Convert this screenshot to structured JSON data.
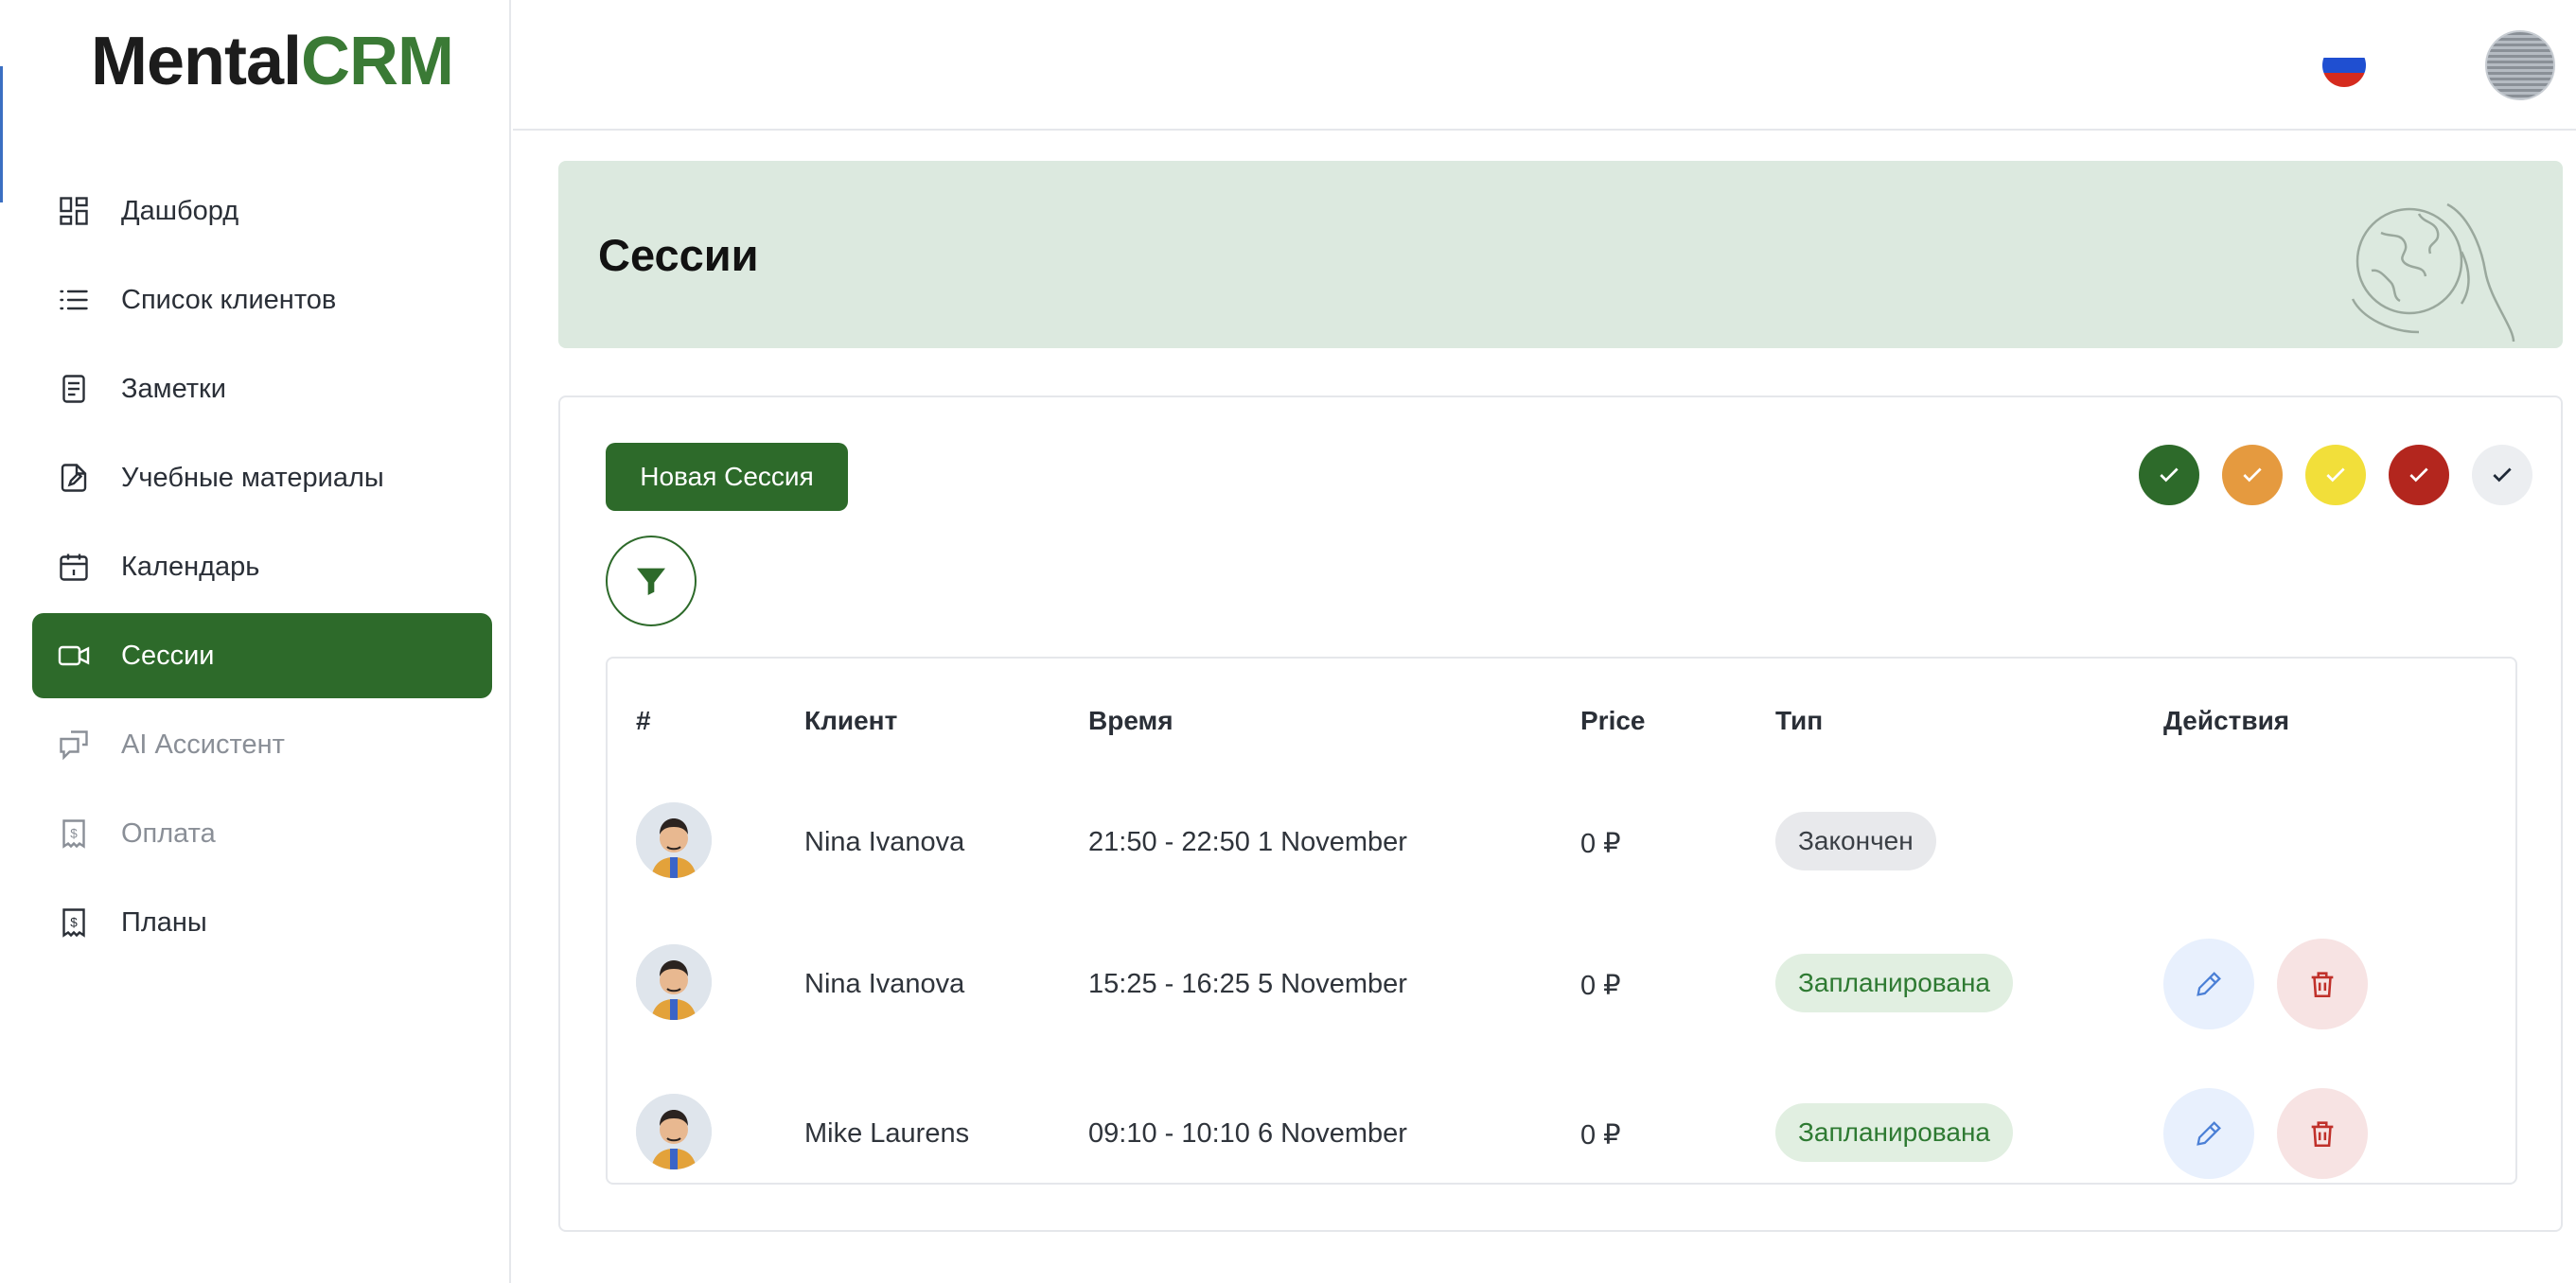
{
  "brand": {
    "part1": "Mental",
    "part2": "CRM"
  },
  "sidebar": {
    "items": [
      {
        "label": "Дашборд",
        "icon": "dashboard-icon"
      },
      {
        "label": "Список клиентов",
        "icon": "list-icon"
      },
      {
        "label": "Заметки",
        "icon": "notes-icon"
      },
      {
        "label": "Учебные материалы",
        "icon": "document-edit-icon"
      },
      {
        "label": "Календарь",
        "icon": "calendar-icon"
      },
      {
        "label": "Сессии",
        "icon": "video-icon",
        "active": true
      },
      {
        "label": "AI Ассистент",
        "icon": "chat-icon",
        "muted": true
      },
      {
        "label": "Оплата",
        "icon": "receipt-icon",
        "muted": true
      },
      {
        "label": "Планы",
        "icon": "receipt-icon"
      }
    ]
  },
  "header": {
    "language": "ru",
    "flag_colors": [
      "#ffffff",
      "#1f4fd1",
      "#d52b1e"
    ]
  },
  "page": {
    "title": "Сессии"
  },
  "toolbar": {
    "new_session_label": "Новая Сессия"
  },
  "status_colors": [
    "#2d6a2a",
    "#e59a3f",
    "#f2df3a",
    "#b3261e",
    "#eceef1"
  ],
  "table": {
    "headers": {
      "num": "#",
      "client": "Клиент",
      "time": "Время",
      "price": "Price",
      "type": "Тип",
      "actions": "Действия"
    },
    "rows": [
      {
        "client": "Nina Ivanova",
        "time": "21:50 - 22:50 1 November",
        "price": "0 ₽",
        "type": "Закончен",
        "status": "done",
        "actions": false
      },
      {
        "client": "Nina Ivanova",
        "time": "15:25 - 16:25 5 November",
        "price": "0 ₽",
        "type": "Запланирована",
        "status": "planned",
        "actions": true
      },
      {
        "client": "Mike Laurens",
        "time": "09:10 - 10:10 6 November",
        "price": "0 ₽",
        "type": "Запланирована",
        "status": "planned",
        "actions": true
      }
    ]
  }
}
